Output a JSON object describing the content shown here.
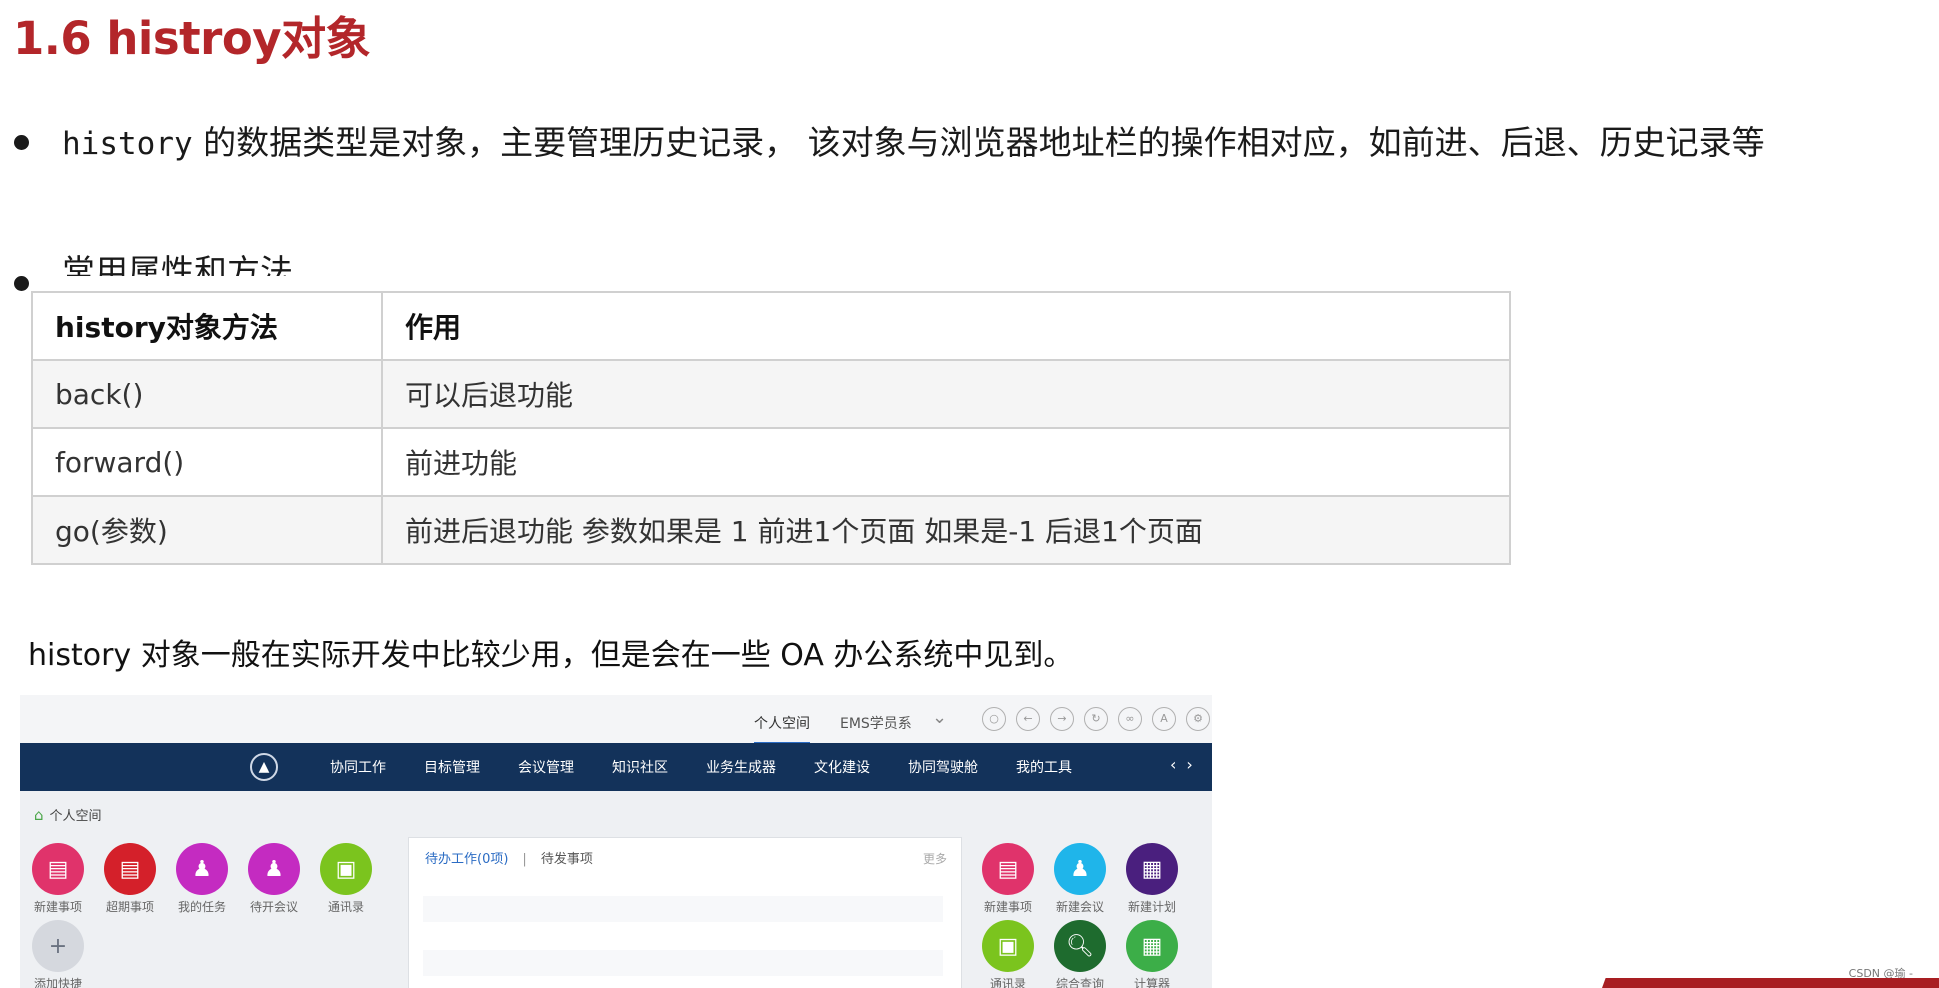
{
  "heading": "1.6 histroy对象",
  "bullet1": {
    "code": "history",
    "text": " 的数据类型是对象，主要管理历史记录， 该对象与浏览器地址栏的操作相对应，如前进、后退、历史记录等"
  },
  "bullet2": {
    "text": "常用属性和方法"
  },
  "table": {
    "headers": [
      "history对象方法",
      "作用"
    ],
    "rows": [
      [
        "back()",
        "可以后退功能"
      ],
      [
        "forward()",
        "前进功能"
      ],
      [
        "go(参数)",
        "前进后退功能 参数如果是 1 前进1个页面 如果是-1 后退1个页面"
      ]
    ]
  },
  "note": "history 对象一般在实际开发中比较少用，但是会在一些 OA 办公系统中见到。",
  "oa": {
    "top_tabs": [
      "个人空间",
      "EMS学员系"
    ],
    "menu": [
      "协同工作",
      "目标管理",
      "会议管理",
      "知识社区",
      "业务生成器",
      "文化建设",
      "协同驾驶舱",
      "我的工具"
    ],
    "breadcrumb": "个人空间",
    "left_apps": [
      {
        "label": "新建事项",
        "color": "#e0336b"
      },
      {
        "label": "超期事项",
        "color": "#d4202a"
      },
      {
        "label": "我的任务",
        "color": "#c42bc1"
      },
      {
        "label": "待开会议",
        "color": "#c42bc1"
      },
      {
        "label": "通讯录",
        "color": "#7bc41e"
      }
    ],
    "add_app": {
      "label": "添加快捷"
    },
    "panel": {
      "tab_active": "待办工作(0项)",
      "tab_other": "待发事项",
      "more": "更多"
    },
    "right_apps_row1": [
      {
        "label": "新建事项",
        "color": "#e0336b"
      },
      {
        "label": "新建会议",
        "color": "#1fb5ea"
      },
      {
        "label": "新建计划",
        "color": "#4a1f7e"
      }
    ],
    "right_apps_row2": [
      {
        "label": "通讯录",
        "color": "#7bc41e"
      },
      {
        "label": "综合查询",
        "color": "#1e6b2e"
      },
      {
        "label": "计算器",
        "color": "#3cae48"
      }
    ]
  },
  "watermark": "CSDN @瑜 -"
}
